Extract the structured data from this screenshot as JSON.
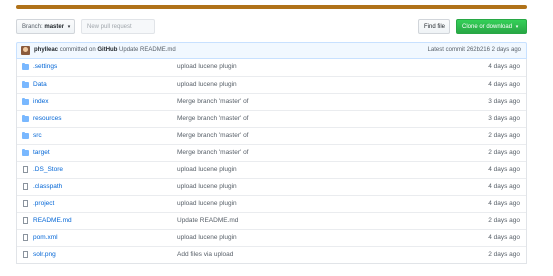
{
  "colors": {
    "language_bar": "#b07219",
    "link": "#0366d6",
    "clone_button": "#28a745"
  },
  "toolbar": {
    "branch_prefix": "Branch:",
    "branch_name": "master",
    "new_pr_label": "New pull request",
    "find_file_label": "Find file",
    "clone_label": "Clone or download"
  },
  "commit": {
    "author": "phylleac",
    "committed_on": "committed on",
    "platform": "GitHub",
    "message": "Update README.md",
    "latest_label": "Latest commit 262b216 2 days ago"
  },
  "files": [
    {
      "name": ".settings",
      "type": "dir",
      "icon": "folder-icon",
      "message": "upload lucene plugin",
      "age": "4 days ago"
    },
    {
      "name": "Data",
      "type": "dir",
      "icon": "folder-icon",
      "message": "upload lucene plugin",
      "age": "4 days ago"
    },
    {
      "name": "index",
      "type": "dir",
      "icon": "folder-icon",
      "message": "Merge branch 'master' of",
      "age": "3 days ago"
    },
    {
      "name": "resources",
      "type": "dir",
      "icon": "folder-icon",
      "message": "Merge branch 'master' of",
      "age": "3 days ago"
    },
    {
      "name": "src",
      "type": "dir",
      "icon": "folder-icon",
      "message": "Merge branch 'master' of",
      "age": "2 days ago"
    },
    {
      "name": "target",
      "type": "dir",
      "icon": "folder-icon",
      "message": "Merge branch 'master' of",
      "age": "2 days ago"
    },
    {
      "name": ".DS_Store",
      "type": "file",
      "icon": "file-icon",
      "message": "upload lucene plugin",
      "age": "4 days ago"
    },
    {
      "name": ".classpath",
      "type": "file",
      "icon": "file-icon",
      "message": "upload lucene plugin",
      "age": "4 days ago"
    },
    {
      "name": ".project",
      "type": "file",
      "icon": "file-icon",
      "message": "upload lucene plugin",
      "age": "4 days ago"
    },
    {
      "name": "README.md",
      "type": "file",
      "icon": "file-icon",
      "message": "Update README.md",
      "age": "2 days ago"
    },
    {
      "name": "pom.xml",
      "type": "file",
      "icon": "file-icon",
      "message": "upload lucene plugin",
      "age": "4 days ago"
    },
    {
      "name": "solr.png",
      "type": "file",
      "icon": "file-icon",
      "message": "Add files via upload",
      "age": "2 days ago"
    }
  ]
}
